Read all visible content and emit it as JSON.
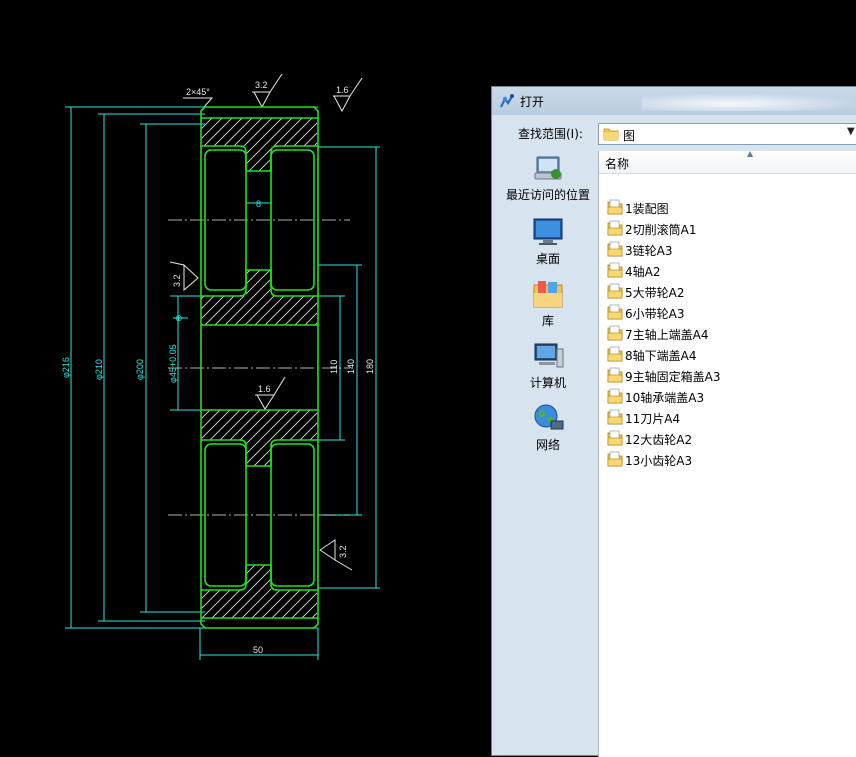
{
  "drawing": {
    "dims": {
      "chamfer": "2×45°",
      "rough_top_left": "3.2",
      "rough_top_right": "1.6",
      "rough_left": "3.2",
      "rough_center": "1.6",
      "rough_right": "3.2",
      "hub_width": "8",
      "dia_outer": "φ216",
      "dia_root": "φ210",
      "dia_web": "φ200",
      "bore": "φ45+0.05",
      "sym": "⊕",
      "v1": "110",
      "v2": "140",
      "v3": "180",
      "width": "50"
    }
  },
  "dialog": {
    "title": "打开",
    "lookin_label": "查找范围(I):",
    "lookin_value": "图",
    "places": [
      {
        "label": "最近访问的位置",
        "icon": "recent-places-icon"
      },
      {
        "label": "桌面",
        "icon": "desktop-icon"
      },
      {
        "label": "库",
        "icon": "library-icon"
      },
      {
        "label": "计算机",
        "icon": "computer-icon"
      },
      {
        "label": "网络",
        "icon": "network-icon"
      }
    ],
    "column_name": "名称",
    "files": [
      "1装配图",
      "2切削滚筒A1",
      "3链轮A3",
      "4轴A2",
      "5大带轮A2",
      "6小带轮A3",
      "7主轴上端盖A4",
      "8轴下端盖A4",
      "9主轴固定箱盖A3",
      "10轴承端盖A3",
      "11刀片A4",
      "12大齿轮A2",
      "13小齿轮A3"
    ]
  }
}
